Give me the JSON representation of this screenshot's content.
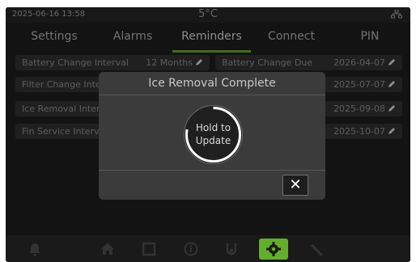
{
  "status": {
    "datetime": "2025-06-16  13:58",
    "temperature": "5°C",
    "network_icon": "network-icon"
  },
  "tabs": [
    {
      "label": "Settings",
      "active": false
    },
    {
      "label": "Alarms",
      "active": false
    },
    {
      "label": "Reminders",
      "active": true
    },
    {
      "label": "Connect",
      "active": false
    },
    {
      "label": "PIN",
      "active": false
    }
  ],
  "reminders": {
    "left": [
      {
        "label": "Battery Change Interval",
        "value": "12 Months"
      },
      {
        "label": "Filter Change Inte",
        "value": ""
      },
      {
        "label": "Ice Removal Inter",
        "value": ""
      },
      {
        "label": "Fin Service Interv",
        "value": ""
      }
    ],
    "right": [
      {
        "label": "Battery Change Due",
        "value": "2026-04-07"
      },
      {
        "label": "",
        "value": "2025-07-07"
      },
      {
        "label": "",
        "value": "2025-09-08"
      },
      {
        "label": "",
        "value": "2025-10-07"
      }
    ]
  },
  "modal": {
    "title": "Ice Removal Complete",
    "hold_line1": "Hold to",
    "hold_line2": "Update",
    "hold_progress": 0.78,
    "close_label": "✕"
  },
  "nav": {
    "items": [
      "bell-icon",
      "home-icon",
      "square-icon",
      "info-icon",
      "thermometer-icon",
      "gear-icon",
      "wrench-icon"
    ],
    "active": "gear-icon",
    "accent": "#62b029"
  }
}
